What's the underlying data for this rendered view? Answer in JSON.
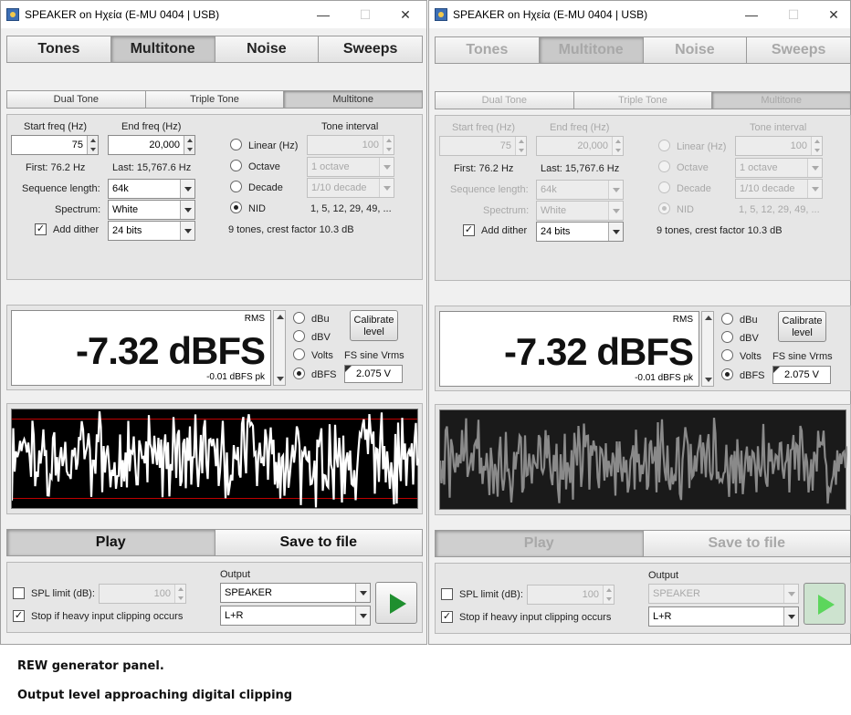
{
  "windows": [
    {
      "title": "SPEAKER on Ηχεία (E-MU 0404 | USB)",
      "tabs": [
        "Tones",
        "Multitone",
        "Noise",
        "Sweeps"
      ],
      "subtabs": [
        "Dual Tone",
        "Triple Tone",
        "Multitone"
      ],
      "start_freq_label": "Start freq (Hz)",
      "end_freq_label": "End freq (Hz)",
      "start_freq": "75",
      "end_freq": "20,000",
      "first": "First: 76.2 Hz",
      "last": "Last: 15,767.6 Hz",
      "sequence_length_label": "Sequence length:",
      "sequence_length": "64k",
      "spectrum_label": "Spectrum:",
      "spectrum": "White",
      "add_dither_label": "Add dither",
      "dither_bits": "24 bits",
      "tone_interval_label": "Tone interval",
      "linear_label": "Linear (Hz)",
      "linear_value": "100",
      "octave_label": "Octave",
      "octave_value": "1 octave",
      "decade_label": "Decade",
      "decade_value": "1/10 decade",
      "nid_label": "NID",
      "nid_value": "1, 5, 12, 29, 49, ...",
      "tones_info": "9 tones, crest factor 10.3 dB",
      "rms_label": "RMS",
      "level": "-7.32 dBFS",
      "peak": "-0.01 dBFS pk",
      "unit_dbu": "dBu",
      "unit_dbv": "dBV",
      "unit_volts": "Volts",
      "unit_dbfs": "dBFS",
      "calibrate_label": "Calibrate level",
      "fs_sine_label": "FS sine Vrms",
      "fs_sine_value": "2.075 V",
      "play_label": "Play",
      "save_label": "Save to file",
      "spl_limit_label": "SPL limit (dB):",
      "spl_limit_value": "100",
      "stop_clip_label": "Stop if heavy input clipping occurs",
      "output_label": "Output",
      "output_device": "SPEAKER",
      "output_channel": "L+R"
    },
    {
      "title": "SPEAKER on Ηχεία (E-MU 0404 | USB)",
      "tabs": [
        "Tones",
        "Multitone",
        "Noise",
        "Sweeps"
      ],
      "subtabs": [
        "Dual Tone",
        "Triple Tone",
        "Multitone"
      ],
      "start_freq_label": "Start freq (Hz)",
      "end_freq_label": "End freq (Hz)",
      "start_freq": "75",
      "end_freq": "20,000",
      "first": "First: 76.2 Hz",
      "last": "Last: 15,767.6 Hz",
      "sequence_length_label": "Sequence length:",
      "sequence_length": "64k",
      "spectrum_label": "Spectrum:",
      "spectrum": "White",
      "add_dither_label": "Add dither",
      "dither_bits": "24 bits",
      "tone_interval_label": "Tone interval",
      "linear_label": "Linear (Hz)",
      "linear_value": "100",
      "octave_label": "Octave",
      "octave_value": "1 octave",
      "decade_label": "Decade",
      "decade_value": "1/10 decade",
      "nid_label": "NID",
      "nid_value": "1, 5, 12, 29, 49, ...",
      "tones_info": "9 tones, crest factor 10.3 dB",
      "rms_label": "RMS",
      "level": "-7.32 dBFS",
      "peak": "-0.01 dBFS pk",
      "unit_dbu": "dBu",
      "unit_dbv": "dBV",
      "unit_volts": "Volts",
      "unit_dbfs": "dBFS",
      "calibrate_label": "Calibrate level",
      "fs_sine_label": "FS sine Vrms",
      "fs_sine_value": "2.075 V",
      "play_label": "Play",
      "save_label": "Save to file",
      "spl_limit_label": "SPL limit (dB):",
      "spl_limit_value": "100",
      "stop_clip_label": "Stop if heavy input clipping occurs",
      "output_label": "Output",
      "output_device": "SPEAKER",
      "output_channel": "L+R"
    }
  ],
  "captions": [
    "REW generator panel.",
    "Output level approaching digital clipping"
  ],
  "colors": {
    "waveform_playing": "#ffffff",
    "waveform_stopped": "#8a8a8a",
    "clip_line": "#c00000",
    "play_icon": "#1f8f2f"
  }
}
